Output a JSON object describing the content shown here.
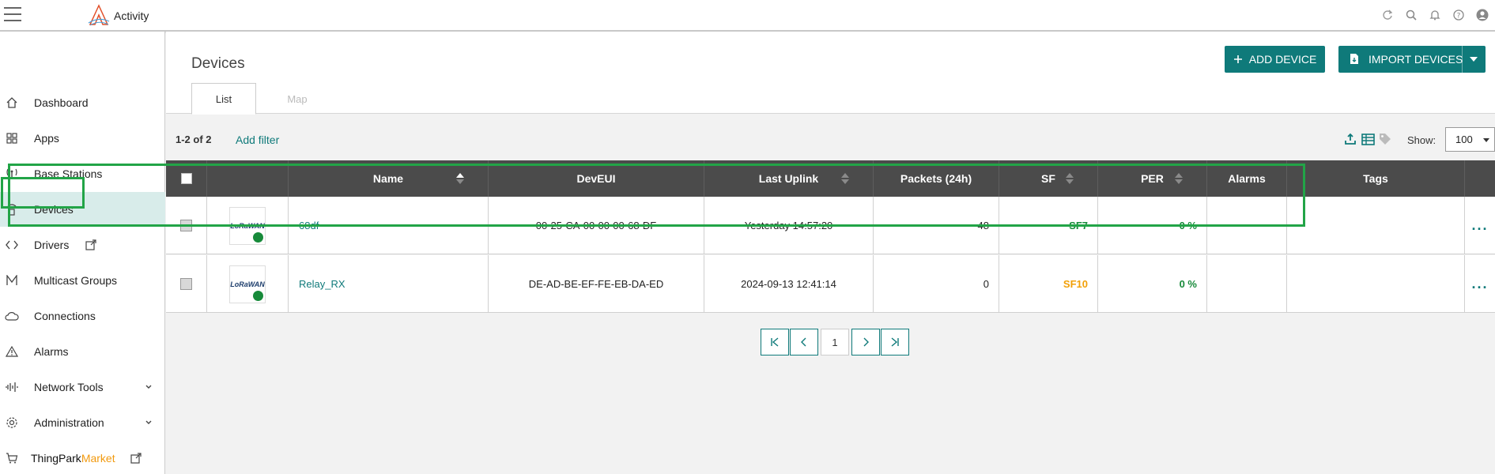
{
  "app": {
    "brand": "Activity",
    "accent": "#0f7a7a",
    "highlight": "#22a447"
  },
  "topbar": {
    "icons": [
      "refresh-icon",
      "search-icon",
      "bell-icon",
      "help-icon",
      "user-icon"
    ]
  },
  "sidebar": {
    "items": [
      {
        "label": "Dashboard",
        "icon": "home-icon"
      },
      {
        "label": "Apps",
        "icon": "grid-icon"
      },
      {
        "label": "Base Stations",
        "icon": "antenna-icon"
      },
      {
        "label": "Devices",
        "icon": "device-icon",
        "active": true
      },
      {
        "label": "Drivers",
        "icon": "code-icon",
        "external": true
      },
      {
        "label": "Multicast Groups",
        "icon": "multicast-icon"
      },
      {
        "label": "Connections",
        "icon": "cloud-icon"
      },
      {
        "label": "Alarms",
        "icon": "warning-icon"
      },
      {
        "label": "Network Tools",
        "icon": "waveform-icon",
        "expandable": true
      },
      {
        "label": "Administration",
        "icon": "gear-icon",
        "expandable": true
      }
    ],
    "market": {
      "label_a": "ThingPark",
      "label_b": "Market",
      "icon": "cart-icon"
    }
  },
  "page": {
    "title": "Devices",
    "add_device": "ADD DEVICE",
    "import_devices": "IMPORT DEVICES",
    "tabs": [
      {
        "label": "List",
        "active": true
      },
      {
        "label": "Map",
        "active": false
      }
    ]
  },
  "toolbar": {
    "count": "1-2 of 2",
    "add_filter": "Add filter",
    "show_label": "Show:",
    "show_value": "100"
  },
  "table": {
    "columns": [
      "Name",
      "DevEUI",
      "Last Uplink",
      "Packets (24h)",
      "SF",
      "PER",
      "Alarms",
      "Tags"
    ],
    "rows": [
      {
        "logo": "LoRaWAN",
        "name": "68df",
        "deveui": "00-25-CA-00-00-00-68-DF",
        "last_uplink": "Yesterday 14:57:20",
        "packets": "48",
        "sf": "SF7",
        "per": "0 %",
        "alarms": "",
        "tags": "",
        "more": "..."
      },
      {
        "logo": "LoRaWAN",
        "name": "Relay_RX",
        "deveui": "DE-AD-BE-EF-FE-EB-DA-ED",
        "last_uplink": "2024-09-13 12:41:14",
        "packets": "0",
        "sf": "SF10",
        "per": "0 %",
        "alarms": "",
        "tags": "",
        "more": "..."
      }
    ]
  },
  "pagination": {
    "current_page": "1"
  }
}
